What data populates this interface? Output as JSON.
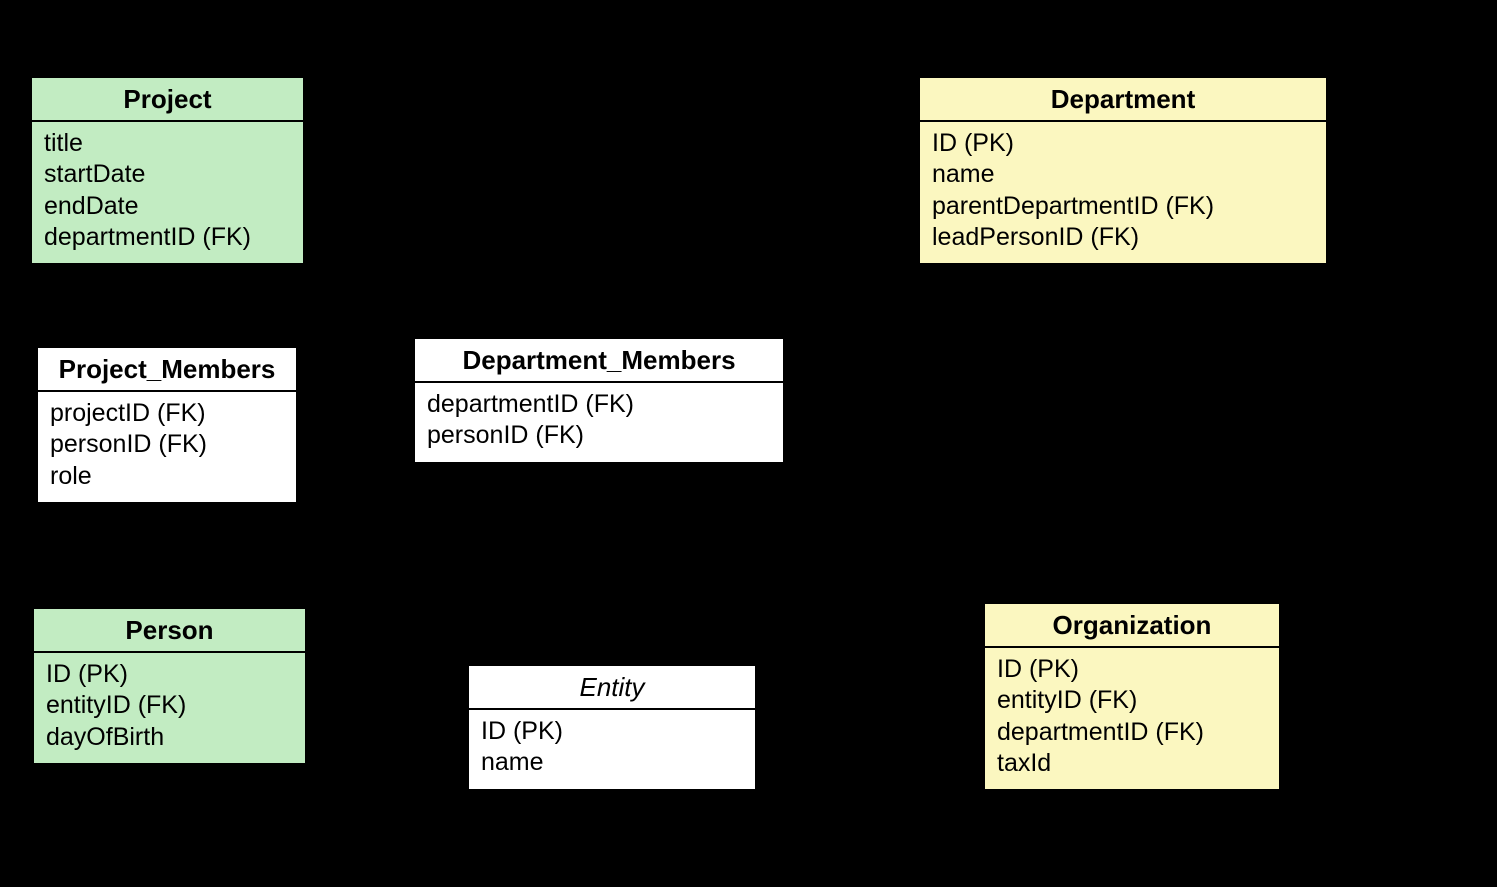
{
  "entities": {
    "project": {
      "title": "Project",
      "attrs": [
        "title",
        "startDate",
        "endDate",
        "departmentID (FK)"
      ]
    },
    "department": {
      "title": "Department",
      "attrs": [
        "ID (PK)",
        "name",
        "parentDepartmentID (FK)",
        "leadPersonID (FK)"
      ]
    },
    "projectMembers": {
      "title": "Project_Members",
      "attrs": [
        "projectID (FK)",
        "personID (FK)",
        "role"
      ]
    },
    "departmentMembers": {
      "title": "Department_Members",
      "attrs": [
        "departmentID (FK)",
        "personID (FK)"
      ]
    },
    "person": {
      "title": "Person",
      "attrs": [
        "ID (PK)",
        "entityID (FK)",
        "dayOfBirth"
      ]
    },
    "entity": {
      "title": "Entity",
      "attrs": [
        "ID (PK)",
        "name"
      ]
    },
    "organization": {
      "title": "Organization",
      "attrs": [
        "ID (PK)",
        "entityID (FK)",
        "departmentID (FK)",
        "taxId"
      ]
    }
  }
}
